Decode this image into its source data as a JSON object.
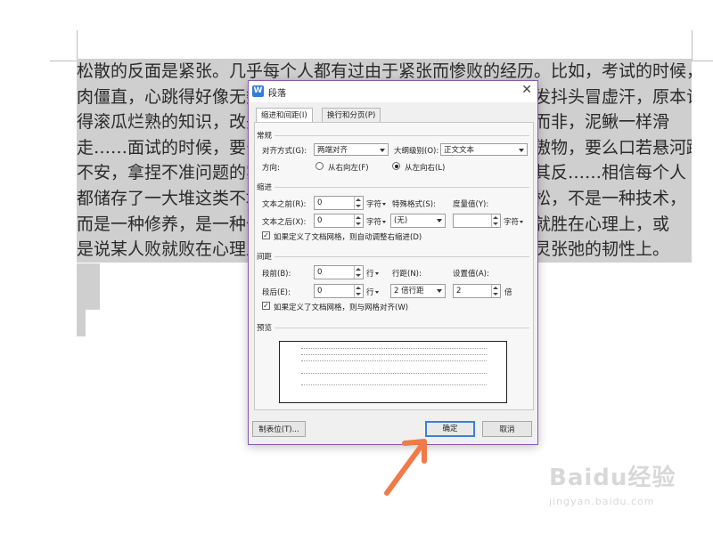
{
  "document": {
    "lines": [
      "松散的反面是紧张。几乎每个人都有过由于紧张而惨败的经历。比如，考试的时候，全身肌",
      "肉僵直，心跳得好像无数只小鹿在胸腔里乱撞，头皮发麻，头发抖头冒虚汗，原本记",
      "得滚瓜烂熟的知识，改头换面之后一下子变得模糊不清，似是而非，泥鳅一样滑",
      "走……面试的时候，要么手足无措，要么拼命表现，要么恃才傲物，要么口若悬河躁动",
      "不安，拿捏不准问题的实质，说着说着就说走了题，结果适得其反……相信每个人",
      "都储存了一大堆这类不堪回首的往事。紧张之后需要心灵的放松，不是一种技术，",
      "而是一种修养，是一种长期积累的心性锤炼。我们常说某人胜就胜在心理上，或",
      "是说某人败就败在心理上，细究起来，更多的是败在了一种心灵张弛的韧性上。"
    ]
  },
  "dialog": {
    "app_icon_letter": "W",
    "title": "段落",
    "close_symbol": "✕",
    "tabs": [
      "缩进和间距(I)",
      "换行和分页(P)"
    ],
    "general": {
      "section": "常规",
      "alignment_label": "对齐方式(G):",
      "alignment_value": "两端对齐",
      "outline_label": "大纲级别(O):",
      "outline_value": "正文文本",
      "direction_label": "方向:",
      "rtl_label": "从右向左(F)",
      "ltr_label": "从左向右(L)",
      "direction_selected": "ltr"
    },
    "indent": {
      "section": "缩进",
      "before_label": "文本之前(R):",
      "before_value": "0",
      "before_unit": "字符",
      "special_label": "特殊格式(S):",
      "special_value": "(无)",
      "measure_label": "度量值(Y):",
      "measure_value": "",
      "measure_unit": "字符",
      "after_label": "文本之后(X):",
      "after_value": "0",
      "after_unit": "字符",
      "grid_check_label": "如果定义了文档网格，则自动调整右缩进(D)",
      "grid_checked": true
    },
    "spacing": {
      "section": "间距",
      "before_label": "段前(B):",
      "before_value": "0",
      "before_unit": "行",
      "line_label": "行距(N):",
      "line_value": "2 倍行距",
      "setting_label": "设置值(A):",
      "setting_value": "2",
      "setting_unit": "倍",
      "after_label": "段后(E):",
      "after_value": "0",
      "after_unit": "行",
      "grid_check_label": "如果定义了文档网格，则与网格对齐(W)",
      "grid_checked": true
    },
    "preview": {
      "section": "预览"
    },
    "buttons": {
      "tabs": "制表位(T)...",
      "ok": "确定",
      "cancel": "取消"
    }
  },
  "watermark": {
    "main": "Baidu经验",
    "sub": "jingyan.baidu.com"
  },
  "colors": {
    "dialog_border": "#8a58b0",
    "ok_border": "#3d7fd6",
    "arrow": "#f07a4a",
    "selection": "#cfcfcf"
  }
}
